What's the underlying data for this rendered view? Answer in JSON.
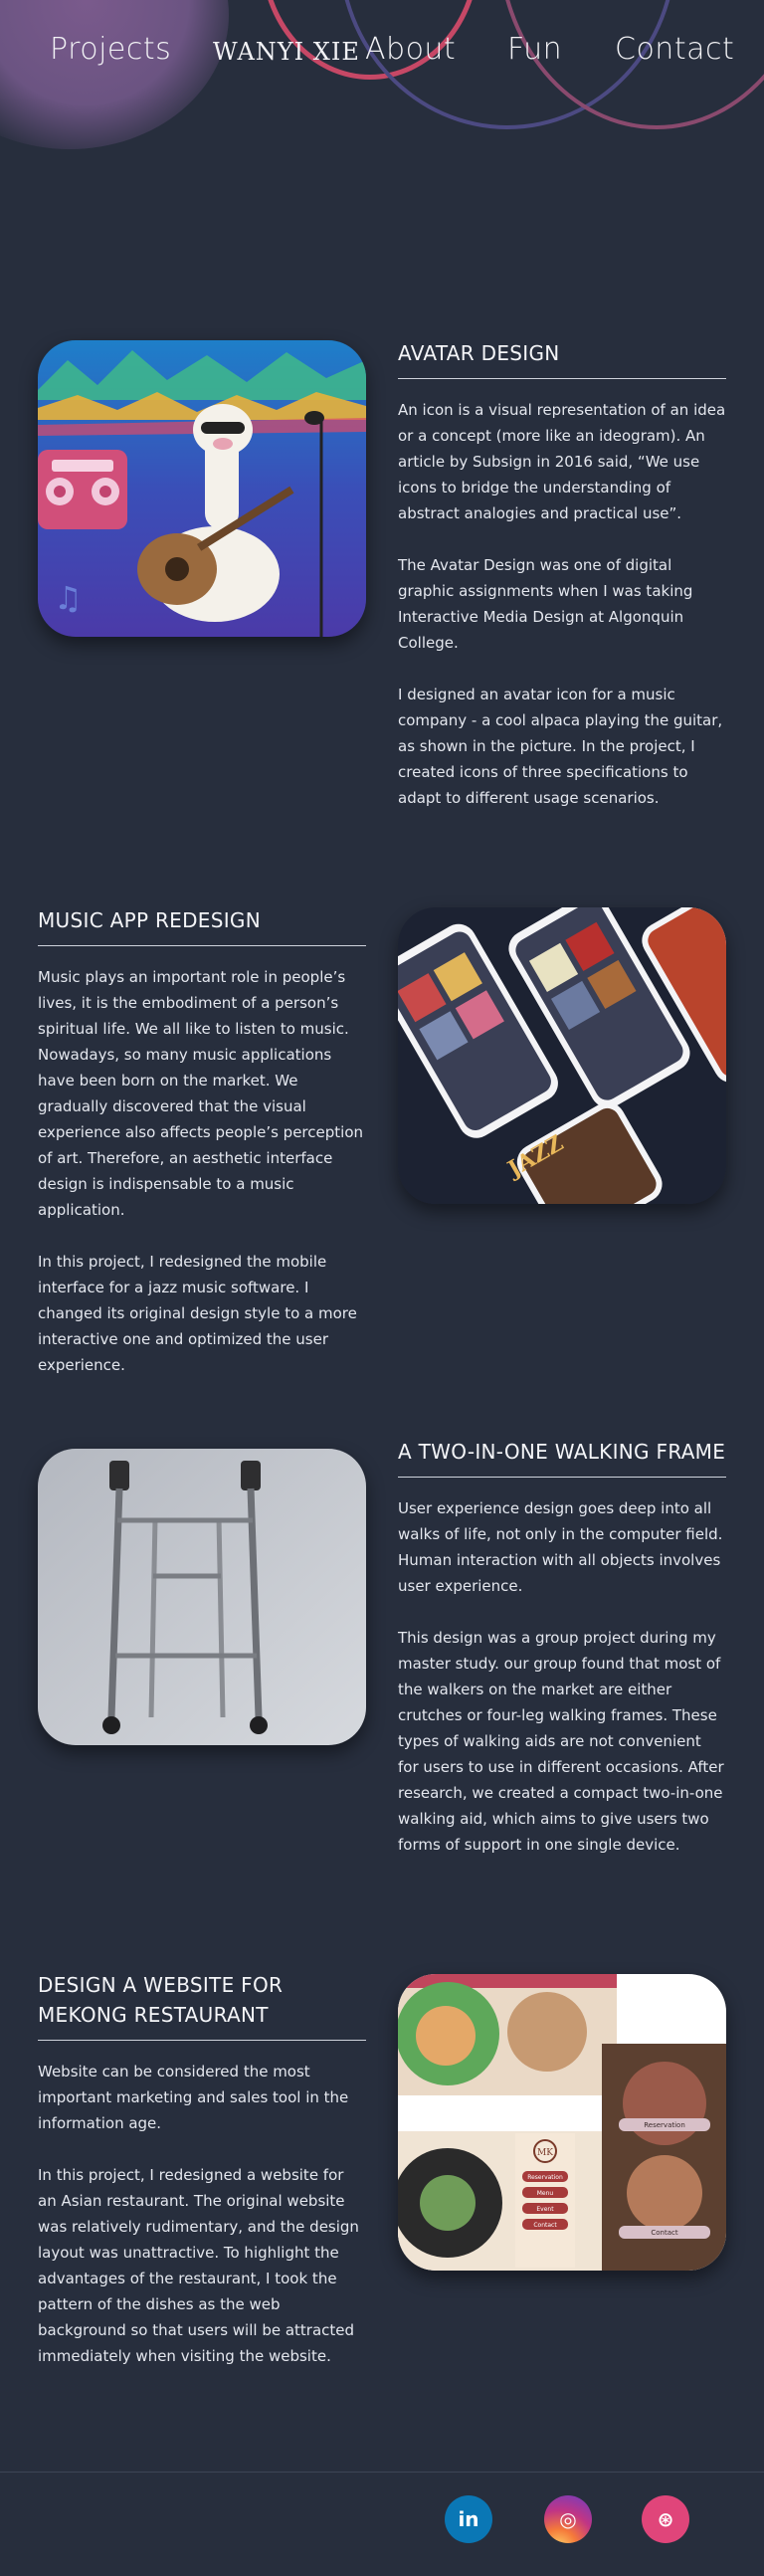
{
  "nav": {
    "projects": "Projects",
    "logo": "WANYI XIE",
    "about": "About",
    "fun": "Fun",
    "contact": "Contact"
  },
  "sections": [
    {
      "title": "AVATAR DESIGN",
      "paragraphs": [
        "An icon is a visual representation of an idea or a concept (more like an ideogram). An article by Subsign in 2016 said, “We use icons to bridge the understanding of abstract analogies and practical use”.",
        "The Avatar Design was one of digital graphic assignments when I was taking Interactive Media Design at Algonquin College.",
        "I designed an avatar icon for a music company - a cool alpaca playing the guitar, as shown in the picture. In the project, I created icons of three specifications to adapt to different usage scenarios."
      ]
    },
    {
      "title": "MUSIC APP REDESIGN",
      "paragraphs": [
        "Music plays an important role in people’s lives, it is the embodiment of a person’s spiritual life. We all like to listen to music. Nowadays, so many music applications have been born on the market. We gradually discovered that the visual experience also affects people’s perception of art. Therefore, an aesthetic interface design is indispensable to a music application.",
        "In this project, I redesigned the mobile interface for a jazz music software. I changed its original design style to a more interactive one and optimized the user experience."
      ],
      "image_text": "JAZZ"
    },
    {
      "title": "A TWO-IN-ONE WALKING FRAME",
      "paragraphs": [
        "User experience design goes deep into all walks of life, not only in the computer field. Human interaction with all objects involves user experience.",
        "This design was a group project during my master study. our group found that most of the walkers on the market are either crutches or four-leg walking frames. These types of walking aids are not convenient for users to use in different occasions. After research, we created a compact two-in-one walking aid, which aims to give users two forms of support in one single device."
      ]
    },
    {
      "title": "DESIGN A WEBSITE FOR MEKONG RESTAURANT",
      "paragraphs": [
        "Website can be considered the most important marketing and sales tool in the information age.",
        "In this project, I redesigned a website for an Asian restaurant. The original website was relatively rudimentary, and the design layout was unattractive. To highlight the advantages of the restaurant, I took the pattern of the dishes as the web background so that users will be attracted immediately when visiting the website."
      ],
      "image_menu": [
        "Reservation",
        "Menu",
        "Event",
        "Contact"
      ],
      "image_logo": "MK",
      "image_buttons": [
        "Reservation",
        "Contact"
      ]
    }
  ],
  "social": [
    {
      "name": "linkedin",
      "label": "in",
      "color": "#0a77b5"
    },
    {
      "name": "instagram",
      "label": "◎",
      "color": "#c13584"
    },
    {
      "name": "dribbble",
      "label": "⊛",
      "color": "#e0457a"
    }
  ]
}
